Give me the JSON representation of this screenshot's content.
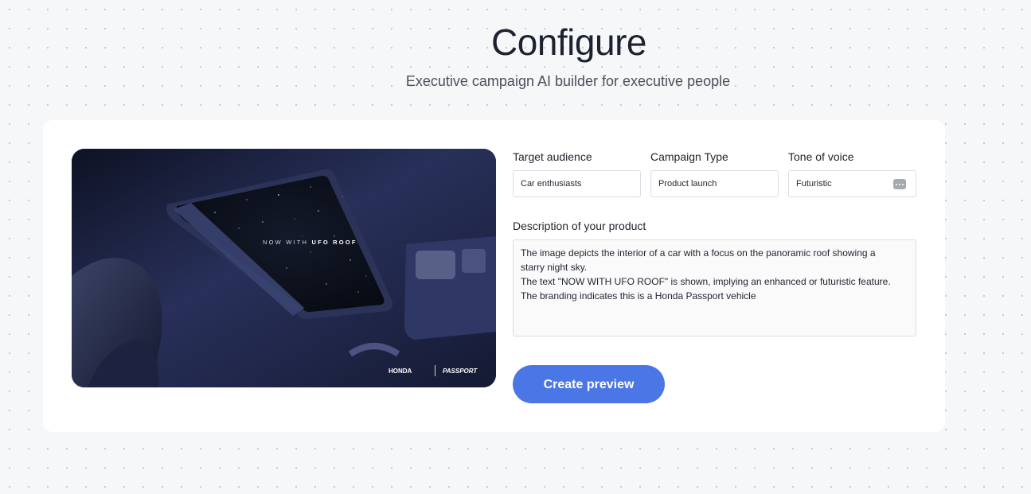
{
  "header": {
    "title": "Configure",
    "subtitle": "Executive campaign AI builder for executive people"
  },
  "hero": {
    "overlay_text_prefix": "NOW WITH ",
    "overlay_text_bold": "UFO ROOF",
    "brand_left": "HONDA",
    "brand_right": "PASSPORT"
  },
  "form": {
    "target_audience": {
      "label": "Target audience",
      "value": "Car enthusiasts"
    },
    "campaign_type": {
      "label": "Campaign Type",
      "value": "Product launch"
    },
    "tone_of_voice": {
      "label": "Tone of voice",
      "value": "Futuristic",
      "icon": "more-dots-icon"
    },
    "description": {
      "label": "Description of your product",
      "lines": [
        "The image depicts the interior of a car with a focus on the panoramic roof showing a",
        "starry night sky.",
        "The text \"NOW WITH UFO ROOF\" is shown, implying an enhanced or futuristic feature.",
        "The branding indicates this is a Honda Passport vehicle"
      ]
    },
    "submit_label": "Create preview"
  },
  "colors": {
    "accent": "#4a77e5",
    "background": "#f6f7f9",
    "card": "#ffffff"
  }
}
